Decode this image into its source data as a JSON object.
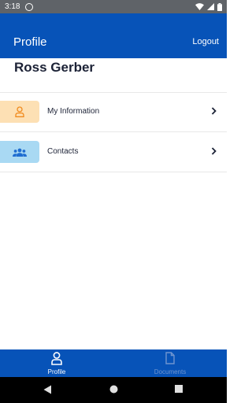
{
  "status_bar": {
    "time": "3:18"
  },
  "app_bar": {
    "title": "Profile",
    "logout_label": "Logout"
  },
  "profile": {
    "name": "Ross Gerber"
  },
  "menu": [
    {
      "label": "My Information",
      "icon": "person-icon",
      "icon_bg": "#fde0b4",
      "icon_color": "#f08a1e"
    },
    {
      "label": "Contacts",
      "icon": "group-icon",
      "icon_bg": "#a9d9f3",
      "icon_color": "#1f6dd1"
    }
  ],
  "bottom_nav": [
    {
      "label": "Profile",
      "icon": "profile-icon",
      "active": true
    },
    {
      "label": "Documents",
      "icon": "document-icon",
      "active": false
    }
  ],
  "colors": {
    "primary": "#0753b8",
    "text_dark": "#1c2236",
    "inactive_nav": "#6f95d0"
  }
}
